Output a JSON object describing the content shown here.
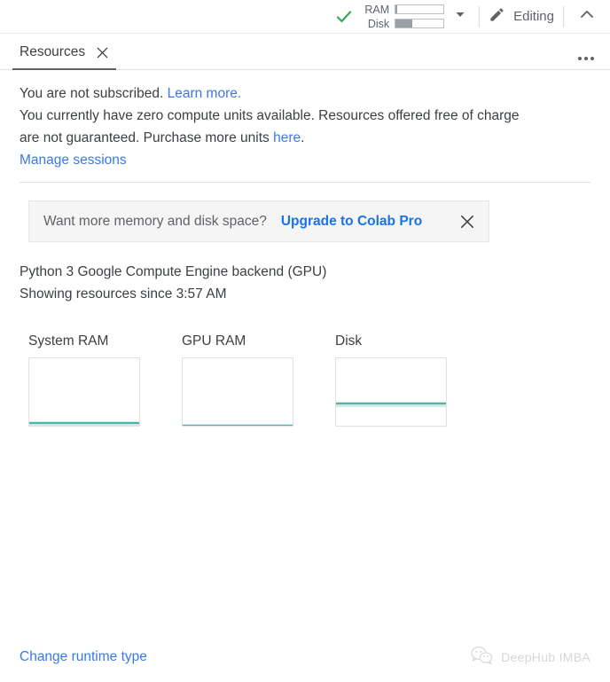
{
  "topbar": {
    "status_icon": "green-check-icon",
    "ram_label": "RAM",
    "disk_label": "Disk",
    "ram_percent": 4,
    "disk_percent": 35,
    "dropdown_icon": "caret-down-icon",
    "editing_icon": "pencil-icon",
    "editing_label": "Editing",
    "collapse_icon": "chevron-up-icon"
  },
  "tabbar": {
    "tab_label": "Resources",
    "close_icon": "close-icon",
    "overflow_icon": "more-options-icon"
  },
  "subscription": {
    "line1_plain": "You are not subscribed.",
    "line1_link": "Learn more.",
    "line2": "You currently have zero compute units available. Resources offered free of charge",
    "line3_plain_a": "are not guaranteed. Purchase more units",
    "line3_link": "here",
    "line3_plain_b": ".",
    "manage_sessions": "Manage sessions"
  },
  "promo": {
    "text": "Want more memory and disk space?",
    "cta": "Upgrade to Colab Pro",
    "close_icon": "close-icon",
    "background": "#f5f5f5"
  },
  "backend": {
    "line1": "Python 3 Google Compute Engine backend (GPU)",
    "line2": "Showing resources since 3:57 AM"
  },
  "footer": {
    "change_runtime": "Change runtime type",
    "watermark_icon": "wechat-logo-icon",
    "watermark_text": "DeepHub IMBA"
  },
  "colors": {
    "link": "#3b78e7",
    "link_strong": "#1a73e8",
    "chart_line": "#4db6ac",
    "check_green": "#34a853",
    "text": "#3c4043",
    "muted": "#5f6368"
  },
  "chart_data": [
    {
      "type": "line",
      "title": "System RAM",
      "x": [
        0,
        1,
        2,
        3,
        4,
        5,
        6,
        7,
        8,
        9,
        10
      ],
      "values": [
        5,
        5,
        5,
        5,
        5,
        5,
        5,
        5,
        5,
        5,
        5
      ],
      "ylim": [
        0,
        100
      ],
      "ylabel": "",
      "xlabel": "",
      "grid": false,
      "legend": "none",
      "line_color": "#4db6ac"
    },
    {
      "type": "line",
      "title": "GPU RAM",
      "x": [
        0,
        1,
        2,
        3,
        4,
        5,
        6,
        7,
        8,
        9,
        10
      ],
      "values": [
        1,
        1,
        1,
        1,
        1,
        1,
        1,
        1,
        1,
        1,
        1
      ],
      "ylim": [
        0,
        100
      ],
      "ylabel": "",
      "xlabel": "",
      "grid": false,
      "legend": "none",
      "line_color": "#4db6ac"
    },
    {
      "type": "line",
      "title": "Disk",
      "x": [
        0,
        1,
        2,
        3,
        4,
        5,
        6,
        7,
        8,
        9,
        10
      ],
      "values": [
        33,
        33,
        33,
        33,
        33,
        33,
        33,
        33,
        33,
        33,
        33
      ],
      "ylim": [
        0,
        100
      ],
      "ylabel": "",
      "xlabel": "",
      "grid": false,
      "legend": "none",
      "line_color": "#4db6ac"
    }
  ]
}
